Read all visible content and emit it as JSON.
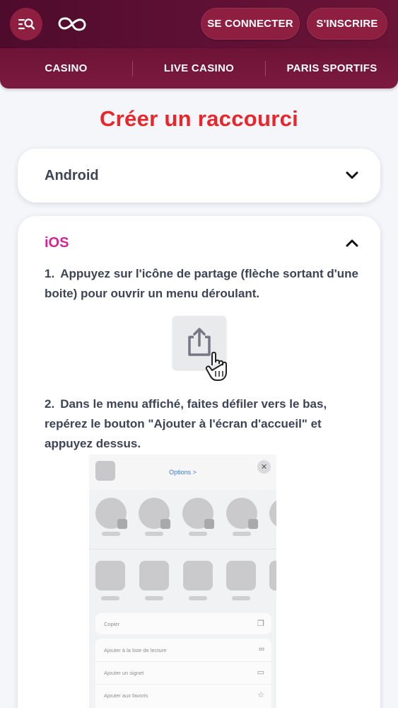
{
  "header": {
    "menu_icon": "menu-search-icon",
    "logo_icon": "infinity-logo-icon",
    "login_label": "SE CONNECTER",
    "signup_label": "S'INSCRIRE"
  },
  "nav": {
    "items": [
      {
        "label": "CASINO"
      },
      {
        "label": "LIVE CASINO"
      },
      {
        "label": "PARIS SPORTIFS"
      }
    ]
  },
  "page": {
    "title": "Créer un raccourci"
  },
  "android": {
    "title": "Android",
    "chevron_icon": "chevron-down-icon"
  },
  "ios": {
    "title": "iOS",
    "chevron_icon": "chevron-up-icon",
    "steps": [
      {
        "number": "1.",
        "text": "Appuyez sur l'icône de partage (flèche sortant d'une boite) pour ouvrir un menu déroulant."
      },
      {
        "number": "2.",
        "text": "Dans le menu affiché, faites défiler vers le bas, repérez le bouton \"Ajouter à l'écran d'accueil\" et appuyez dessus."
      }
    ],
    "share_icon": "share-icon",
    "pointer_icon": "hand-pointer-icon",
    "screenshot": {
      "options_label": "Options >",
      "close_glyph": "✕",
      "menu_rows": [
        {
          "label": "Copier",
          "icon": "copy-icon"
        },
        {
          "label": "Ajouter à la liste de lecture",
          "icon": "glasses-icon"
        },
        {
          "label": "Ajouter un signet",
          "icon": "book-icon"
        },
        {
          "label": "Ajouter aux favoris",
          "icon": "star-icon"
        }
      ]
    }
  },
  "colors": {
    "header_bg": "#5c0f33",
    "pill_bg": "#8e1f40",
    "title_red": "#e8262c",
    "ios_pink": "#d42591",
    "text_dark": "#3d4456"
  }
}
